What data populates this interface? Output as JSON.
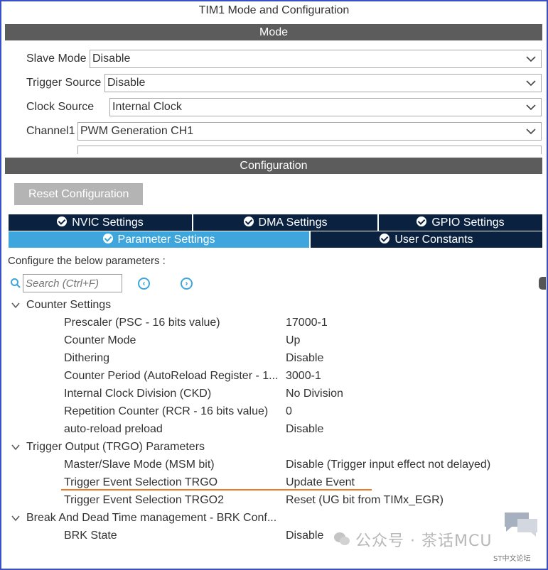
{
  "window": {
    "title": "TIM1 Mode and Configuration"
  },
  "mode": {
    "header": "Mode",
    "fields": [
      {
        "label": "Slave Mode",
        "value": "Disable"
      },
      {
        "label": "Trigger Source",
        "value": "Disable"
      },
      {
        "label": "Clock Source",
        "value": "Internal Clock"
      },
      {
        "label": "Channel1",
        "value": "PWM Generation CH1"
      }
    ]
  },
  "configuration": {
    "header": "Configuration",
    "reset_label": "Reset Configuration",
    "tabs": [
      {
        "label": "NVIC Settings",
        "active": false
      },
      {
        "label": "DMA Settings",
        "active": false
      },
      {
        "label": "GPIO Settings",
        "active": false
      },
      {
        "label": "Parameter Settings",
        "active": true
      },
      {
        "label": "User Constants",
        "active": false
      }
    ],
    "hint": "Configure the below parameters :",
    "search_placeholder": "Search (Ctrl+F)"
  },
  "tree": {
    "groups": [
      {
        "label": "Counter Settings",
        "params": [
          {
            "name": "Prescaler (PSC - 16 bits value)",
            "value": "17000-1"
          },
          {
            "name": "Counter Mode",
            "value": "Up"
          },
          {
            "name": "Dithering",
            "value": "Disable"
          },
          {
            "name": "Counter Period (AutoReload Register - 1...",
            "value": "3000-1"
          },
          {
            "name": "Internal Clock Division (CKD)",
            "value": "No Division"
          },
          {
            "name": "Repetition Counter (RCR - 16 bits value)",
            "value": "0"
          },
          {
            "name": "auto-reload preload",
            "value": "Disable"
          }
        ]
      },
      {
        "label": "Trigger Output (TRGO) Parameters",
        "params": [
          {
            "name": "Master/Slave Mode (MSM bit)",
            "value": "Disable (Trigger input effect not delayed)"
          },
          {
            "name": "Trigger Event Selection TRGO",
            "value": "Update Event"
          },
          {
            "name": "Trigger Event Selection TRGO2",
            "value": "Reset (UG bit from TIMx_EGR)"
          }
        ]
      },
      {
        "label": "Break And Dead Time management - BRK Conf...",
        "params": [
          {
            "name": "BRK State",
            "value": "Disable"
          }
        ]
      }
    ]
  },
  "watermark": {
    "text": "公众号 · 茶话MCU",
    "corner_text": "ST中文论坛"
  },
  "colors": {
    "accent": "#3ea6dc",
    "tab_dark": "#0a2240",
    "header_gray": "#5c5c5c",
    "highlight_underline": "#f07a24",
    "frame_border": "#3b4fc4"
  }
}
